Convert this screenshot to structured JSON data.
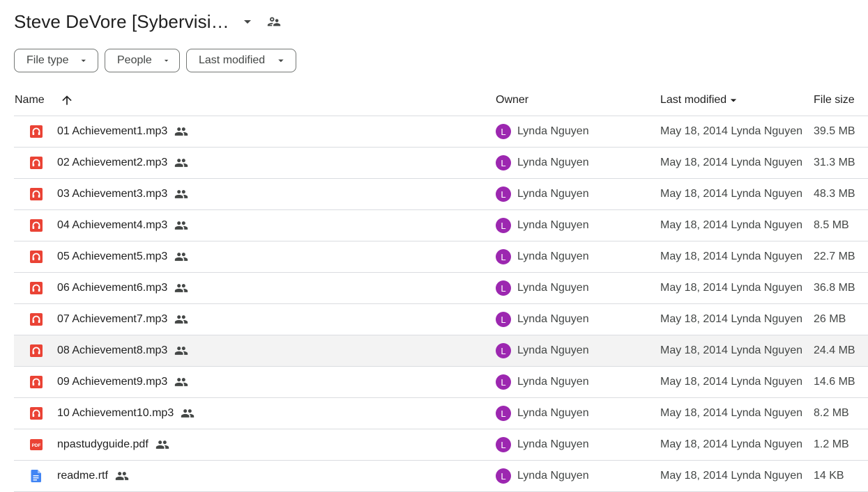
{
  "header": {
    "title": "Steve DeVore [Sybervisi…",
    "caret_icon": "arrow-drop-down-icon",
    "share_icon": "people-outline-icon"
  },
  "filters": [
    {
      "label": "File type"
    },
    {
      "label": "People"
    },
    {
      "label": "Last modified"
    }
  ],
  "columns": {
    "name": "Name",
    "owner": "Owner",
    "last_modified": "Last modified",
    "file_size": "File size"
  },
  "files": [
    {
      "name": "01 Achievement1.mp3",
      "type": "audio",
      "owner": "Lynda Nguyen",
      "owner_initial": "L",
      "modified": "May 18, 2014 Lynda Nguyen",
      "size": "39.5 MB"
    },
    {
      "name": "02 Achievement2.mp3",
      "type": "audio",
      "owner": "Lynda Nguyen",
      "owner_initial": "L",
      "modified": "May 18, 2014 Lynda Nguyen",
      "size": "31.3 MB"
    },
    {
      "name": "03 Achievement3.mp3",
      "type": "audio",
      "owner": "Lynda Nguyen",
      "owner_initial": "L",
      "modified": "May 18, 2014 Lynda Nguyen",
      "size": "48.3 MB"
    },
    {
      "name": "04 Achievement4.mp3",
      "type": "audio",
      "owner": "Lynda Nguyen",
      "owner_initial": "L",
      "modified": "May 18, 2014 Lynda Nguyen",
      "size": "8.5 MB"
    },
    {
      "name": "05 Achievement5.mp3",
      "type": "audio",
      "owner": "Lynda Nguyen",
      "owner_initial": "L",
      "modified": "May 18, 2014 Lynda Nguyen",
      "size": "22.7 MB"
    },
    {
      "name": "06 Achievement6.mp3",
      "type": "audio",
      "owner": "Lynda Nguyen",
      "owner_initial": "L",
      "modified": "May 18, 2014 Lynda Nguyen",
      "size": "36.8 MB"
    },
    {
      "name": "07 Achievement7.mp3",
      "type": "audio",
      "owner": "Lynda Nguyen",
      "owner_initial": "L",
      "modified": "May 18, 2014 Lynda Nguyen",
      "size": "26 MB"
    },
    {
      "name": "08 Achievement8.mp3",
      "type": "audio",
      "owner": "Lynda Nguyen",
      "owner_initial": "L",
      "modified": "May 18, 2014 Lynda Nguyen",
      "size": "24.4 MB"
    },
    {
      "name": "09 Achievement9.mp3",
      "type": "audio",
      "owner": "Lynda Nguyen",
      "owner_initial": "L",
      "modified": "May 18, 2014 Lynda Nguyen",
      "size": "14.6 MB"
    },
    {
      "name": "10 Achievement10.mp3",
      "type": "audio",
      "owner": "Lynda Nguyen",
      "owner_initial": "L",
      "modified": "May 18, 2014 Lynda Nguyen",
      "size": "8.2 MB"
    },
    {
      "name": "npastudyguide.pdf",
      "type": "pdf",
      "owner": "Lynda Nguyen",
      "owner_initial": "L",
      "modified": "May 18, 2014 Lynda Nguyen",
      "size": "1.2 MB"
    },
    {
      "name": "readme.rtf",
      "type": "doc",
      "owner": "Lynda Nguyen",
      "owner_initial": "L",
      "modified": "May 18, 2014 Lynda Nguyen",
      "size": "14 KB"
    }
  ],
  "hovered_row_index": 7,
  "colors": {
    "audio_icon": "#ea4335",
    "pdf_icon": "#ea4335",
    "doc_icon": "#4285f4",
    "avatar": "#9c27b0",
    "hover_row": "#f3f3f3"
  }
}
